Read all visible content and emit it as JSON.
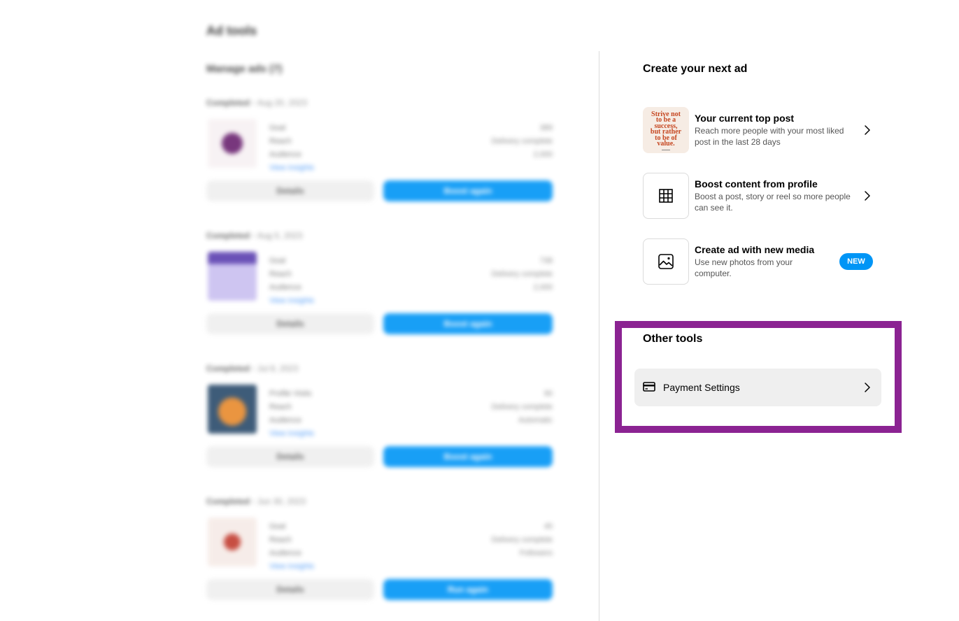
{
  "left": {
    "page_title": "Ad tools",
    "manage_label": "Manage ads (7)",
    "ads": [
      {
        "status": "Completed",
        "date": "Aug 20, 2023",
        "meta": [
          "Goal",
          "Reach",
          "Audience"
        ],
        "link": "View insights",
        "stats": [
          "389",
          "Delivery complete",
          "2,000"
        ],
        "details": "Details",
        "boost": "Boost again"
      },
      {
        "status": "Completed",
        "date": "Aug 5, 2023",
        "meta": [
          "Goal",
          "Reach",
          "Audience"
        ],
        "link": "View insights",
        "stats": [
          "738",
          "Delivery complete",
          "2,000"
        ],
        "details": "Details",
        "boost": "Boost again"
      },
      {
        "status": "Completed",
        "date": "Jul 8, 2023",
        "meta": [
          "Profile Visits",
          "Reach",
          "Audience"
        ],
        "link": "View insights",
        "stats": [
          "90",
          "Delivery complete",
          "Automatic"
        ],
        "details": "Details",
        "boost": "Boost again"
      },
      {
        "status": "Completed",
        "date": "Jun 30, 2023",
        "meta": [
          "Goal",
          "Reach",
          "Audience"
        ],
        "link": "View insights",
        "stats": [
          "45",
          "Delivery complete",
          "Followers"
        ],
        "details": "Details",
        "boost": "Run again"
      }
    ]
  },
  "create": {
    "title": "Create your next ad",
    "options": [
      {
        "title": "Your current top post",
        "desc": "Reach more people with your most liked post in the last 28 days",
        "poster_text": [
          "Strive not",
          "to be a",
          "success,",
          "but rather",
          "to be of",
          "value."
        ],
        "icon": "post-thumbnail"
      },
      {
        "title": "Boost content from profile",
        "desc": "Boost a post, story or reel so more people can see it.",
        "icon": "grid-icon"
      },
      {
        "title": "Create ad with new media",
        "desc": "Use new photos from your computer.",
        "badge": "NEW",
        "icon": "image-icon"
      }
    ]
  },
  "other_tools": {
    "title": "Other tools",
    "payment_label": "Payment Settings",
    "icon": "credit-card-icon"
  },
  "colors": {
    "accent": "#0095f6",
    "highlight": "#8b2392"
  }
}
